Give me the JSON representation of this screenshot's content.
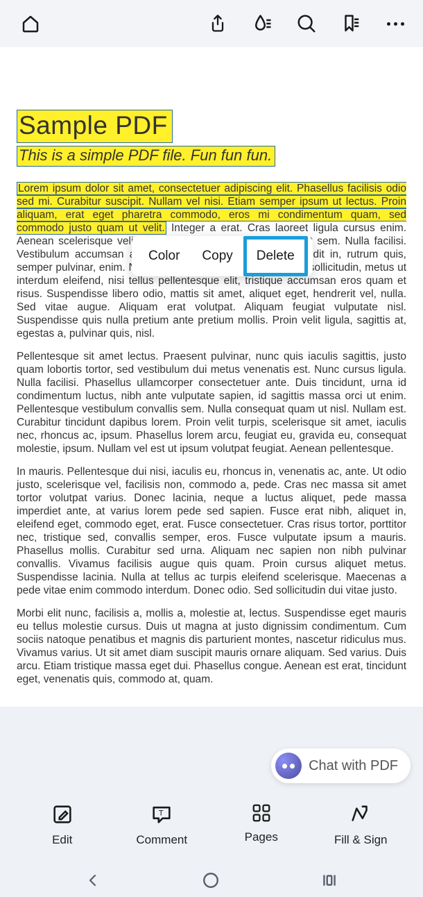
{
  "toolbar": {
    "icons": {
      "home": "home-icon",
      "share": "share-icon",
      "ink": "ink-icon",
      "search": "search-icon",
      "bookmark": "bookmark-icon",
      "more": "more-icon"
    }
  },
  "document": {
    "title": "Sample PDF",
    "subtitle": "This is a simple PDF file. Fun fun fun.",
    "highlighted_paragraph": "Lorem ipsum dolor sit amet, consectetuer adipiscing elit. Phasellus facilisis odio sed mi. Curabitur suscipit. Nullam vel nisi. Etiam semper ipsum ut lectus. Proin aliquam, erat eget pharetra commodo, eros mi condimentum quam, sed commodo justo quam ut velit.",
    "paragraph1_tail": "Integer a erat. Cras laoreet ligula cursus enim. Aenean scelerisque velit et tellus. Vestibulum dictum aliquet sem. Nulla facilisi. Vestibulum accumsan ante vitae elit. Nulla erat dolor, blandit in, rutrum quis, semper pulvinar, enim. Nullam varius congue risus. Vivamus sollicitudin, metus ut interdum eleifend, nisi tellus pellentesque elit, tristique accumsan eros quam et risus. Suspendisse libero odio, mattis sit amet, aliquet eget, hendrerit vel, nulla. Sed vitae augue. Aliquam erat volutpat. Aliquam feugiat vulputate nisl. Suspendisse quis nulla pretium ante pretium mollis. Proin velit ligula, sagittis at, egestas a, pulvinar quis, nisl.",
    "paragraph2": "Pellentesque sit amet lectus. Praesent pulvinar, nunc quis iaculis sagittis, justo quam lobortis tortor, sed vestibulum dui metus venenatis est. Nunc cursus ligula. Nulla facilisi. Phasellus ullamcorper consectetuer ante. Duis tincidunt, urna id condimentum luctus, nibh ante vulputate sapien, id sagittis massa orci ut enim. Pellentesque vestibulum convallis sem. Nulla consequat quam ut nisl. Nullam est. Curabitur tincidunt dapibus lorem. Proin velit turpis, scelerisque sit amet, iaculis nec, rhoncus ac, ipsum. Phasellus lorem arcu, feugiat eu, gravida eu, consequat molestie, ipsum. Nullam vel est ut ipsum volutpat feugiat. Aenean pellentesque.",
    "paragraph3": "In mauris. Pellentesque dui nisi, iaculis eu, rhoncus in, venenatis ac, ante. Ut odio justo, scelerisque vel, facilisis non, commodo a, pede. Cras nec massa sit amet tortor volutpat varius. Donec lacinia, neque a luctus aliquet, pede massa imperdiet ante, at varius lorem pede sed sapien. Fusce erat nibh, aliquet in, eleifend eget, commodo eget, erat. Fusce consectetuer. Cras risus tortor, porttitor nec, tristique sed, convallis semper, eros. Fusce vulputate ipsum a mauris. Phasellus mollis. Curabitur sed urna. Aliquam nec sapien non nibh pulvinar convallis. Vivamus facilisis augue quis quam. Proin cursus aliquet metus. Suspendisse lacinia. Nulla at tellus ac turpis eleifend scelerisque. Maecenas a pede vitae enim commodo interdum. Donec odio. Sed sollicitudin dui vitae justo.",
    "paragraph4": "Morbi elit nunc, facilisis a, mollis a, molestie at, lectus. Suspendisse eget mauris eu tellus molestie cursus. Duis ut magna at justo dignissim condimentum. Cum sociis natoque penatibus et magnis dis parturient montes, nascetur ridiculus mus. Vivamus varius. Ut sit amet diam suscipit mauris ornare aliquam. Sed varius. Duis arcu. Etiam tristique massa eget dui. Phasellus congue. Aenean est erat, tincidunt eget, venenatis quis, commodo at, quam."
  },
  "context_menu": {
    "items": {
      "color": "Color",
      "copy": "Copy",
      "delete": "Delete"
    }
  },
  "chat": {
    "label": "Chat with PDF"
  },
  "actions": {
    "edit": "Edit",
    "comment": "Comment",
    "pages": "Pages",
    "fill_sign": "Fill & Sign"
  }
}
